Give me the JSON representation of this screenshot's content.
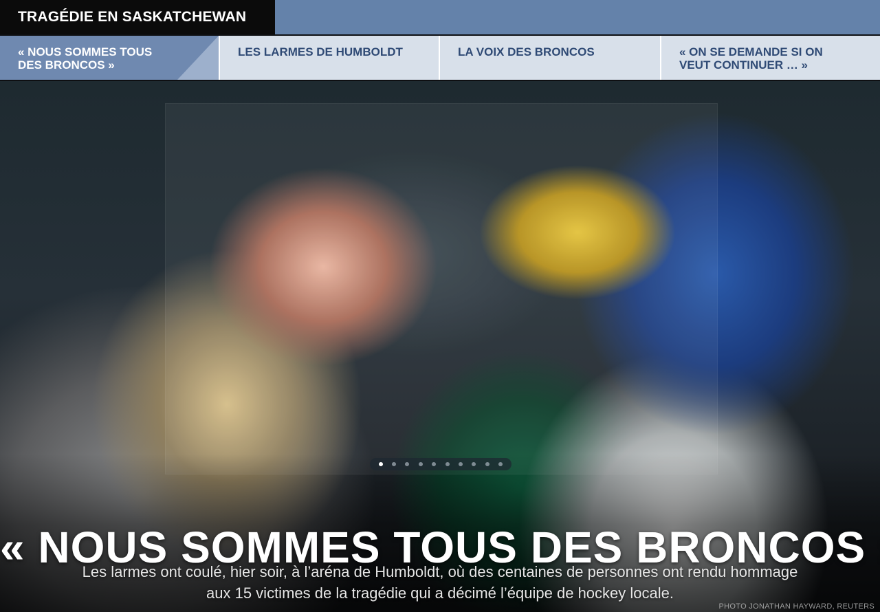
{
  "section": {
    "title": "TRAGÉDIE EN SASKATCHEWAN"
  },
  "tabs": [
    {
      "label": "« NOUS SOMMES TOUS DES BRONCOS »",
      "active": true
    },
    {
      "label": "LES LARMES DE HUMBOLDT",
      "active": false
    },
    {
      "label": "LA VOIX DES BRONCOS",
      "active": false
    },
    {
      "label": "« ON SE DEMANDE SI ON VEUT CONTINUER … »",
      "active": false
    }
  ],
  "colors": {
    "accent": "#6482aa",
    "tab_bg": "#d8e0ea",
    "tab_active_bg": "#6f89b0",
    "tab_text": "#2f4a75"
  },
  "carousel": {
    "slide_count": 10,
    "current_slide": 1
  },
  "hero": {
    "headline": "« NOUS SOMMES TOUS DES BRONCOS »",
    "deck": "Les larmes ont coulé, hier soir, à l’aréna de Humboldt, où des centaines de personnes ont rendu hommage aux 15 victimes de la tragédie qui a décimé l’équipe de hockey locale.",
    "credit": "PHOTO JONATHAN HAYWARD, REUTERS"
  }
}
